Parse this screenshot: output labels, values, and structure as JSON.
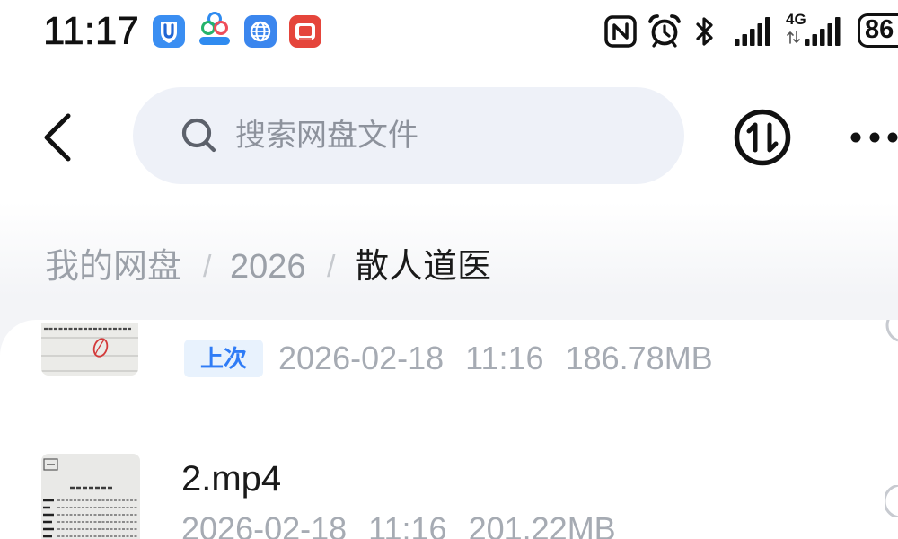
{
  "status_bar": {
    "time": "11:17",
    "app_icons": [
      "shield-app-icon",
      "circles-app-icon",
      "globe-app-icon",
      "book-app-icon"
    ],
    "system_icons": [
      "nfc-icon",
      "alarm-icon",
      "bluetooth-icon",
      "signal-icon",
      "signal-4g-icon",
      "battery-icon"
    ],
    "network_type": "4G",
    "battery_level": "86"
  },
  "header": {
    "back_icon": "chevron-left-icon",
    "search": {
      "icon": "search-icon",
      "placeholder": "搜索网盘文件",
      "value": ""
    },
    "transfer_icon": "transfer-icon",
    "more_icon": "more-icon"
  },
  "breadcrumb": {
    "separator": "/",
    "items": [
      {
        "label": "我的网盘",
        "current": false
      },
      {
        "label": "2026",
        "current": false
      },
      {
        "label": "散人道医",
        "current": true
      }
    ]
  },
  "files": [
    {
      "badge": "上次",
      "date": "2026-02-18",
      "time": "11:16",
      "size": "186.78MB",
      "selected": false
    },
    {
      "name": "2.mp4",
      "date": "2026-02-18",
      "time": "11:16",
      "size": "201.22MB",
      "selected": false
    }
  ],
  "colors": {
    "accent": "#2f7cf6",
    "badge_bg": "#e8f2fd",
    "search_bg": "#eef1f8",
    "page_bg": "#f3f4f7",
    "placeholder": "#8d929c",
    "text_primary": "#1a1a1a",
    "text_secondary": "#a6abb3",
    "breadcrumb_inactive": "#9ba0a8",
    "separator": "#c6c9ce"
  }
}
